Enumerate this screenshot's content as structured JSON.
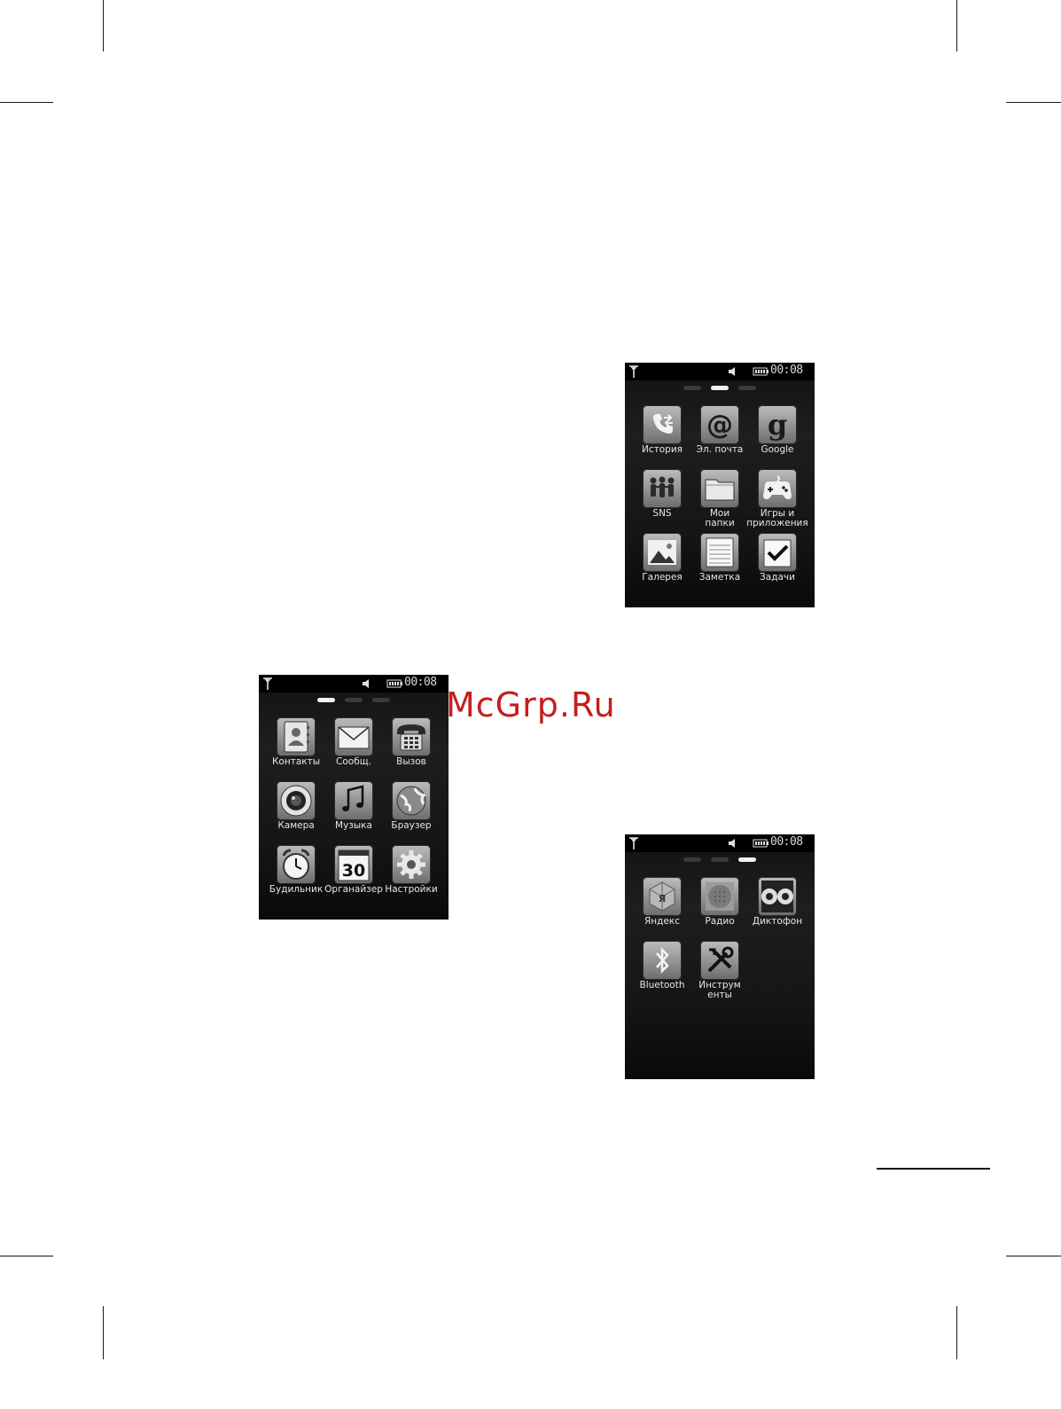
{
  "watermark": "McGrp.Ru",
  "status_bar": {
    "time": "00:08"
  },
  "screens": [
    {
      "active_page": 1,
      "apps": [
        {
          "label": "История",
          "icon": "call-history-icon"
        },
        {
          "label": "Эл. почта",
          "icon": "email-at-icon"
        },
        {
          "label": "Google",
          "icon": "google-icon"
        },
        {
          "label": "SNS",
          "icon": "sns-people-icon"
        },
        {
          "label": "Мои\nпапки",
          "icon": "folder-icon"
        },
        {
          "label": "Игры и\nприложения",
          "icon": "gamepad-icon"
        },
        {
          "label": "Галерея",
          "icon": "gallery-icon"
        },
        {
          "label": "Заметка",
          "icon": "notepad-icon"
        },
        {
          "label": "Задачи",
          "icon": "tasks-check-icon"
        }
      ]
    },
    {
      "active_page": 0,
      "apps": [
        {
          "label": "Контакты",
          "icon": "contacts-icon"
        },
        {
          "label": "Сообщ.",
          "icon": "envelope-icon"
        },
        {
          "label": "Вызов",
          "icon": "phone-icon"
        },
        {
          "label": "Камера",
          "icon": "camera-icon"
        },
        {
          "label": "Музыка",
          "icon": "music-note-icon"
        },
        {
          "label": "Браузер",
          "icon": "globe-icon"
        },
        {
          "label": "Будильник",
          "icon": "alarm-clock-icon"
        },
        {
          "label": "Органайзер",
          "icon": "calendar-icon",
          "badge": "30"
        },
        {
          "label": "Настройки",
          "icon": "gear-icon"
        }
      ]
    },
    {
      "active_page": 2,
      "apps": [
        {
          "label": "Яндекс",
          "icon": "yandex-icon",
          "badge": "Я"
        },
        {
          "label": "Радио",
          "icon": "radio-icon"
        },
        {
          "label": "Диктофон",
          "icon": "voice-recorder-icon"
        },
        {
          "label": "Bluetooth",
          "icon": "bluetooth-icon"
        },
        {
          "label": "Инструм\nенты",
          "icon": "tools-icon"
        }
      ]
    }
  ]
}
